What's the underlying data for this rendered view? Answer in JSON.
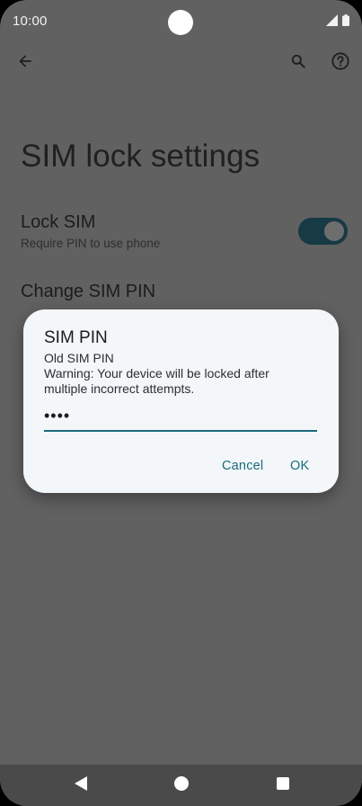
{
  "status_bar": {
    "time": "10:00"
  },
  "page": {
    "title": "SIM lock settings",
    "lock_sim": {
      "title": "Lock SIM",
      "summary": "Require PIN to use phone",
      "enabled": true
    },
    "change_pin": {
      "title": "Change SIM PIN"
    }
  },
  "dialog": {
    "title": "SIM PIN",
    "label": "Old SIM PIN",
    "warning": "Warning: Your device will be locked after multiple incorrect attempts.",
    "pin_value": "••••",
    "cancel_label": "Cancel",
    "ok_label": "OK"
  },
  "icons": {
    "back": "arrow-back-icon",
    "search": "search-icon",
    "help": "help-icon",
    "signal": "signal-icon",
    "battery": "battery-icon"
  },
  "colors": {
    "scrim_background": "#616161",
    "dialog_background": "#f3f7fa",
    "accent": "#1b6a7a",
    "toggle_track": "#173a45",
    "nav_bar": "#4a4a4a"
  }
}
